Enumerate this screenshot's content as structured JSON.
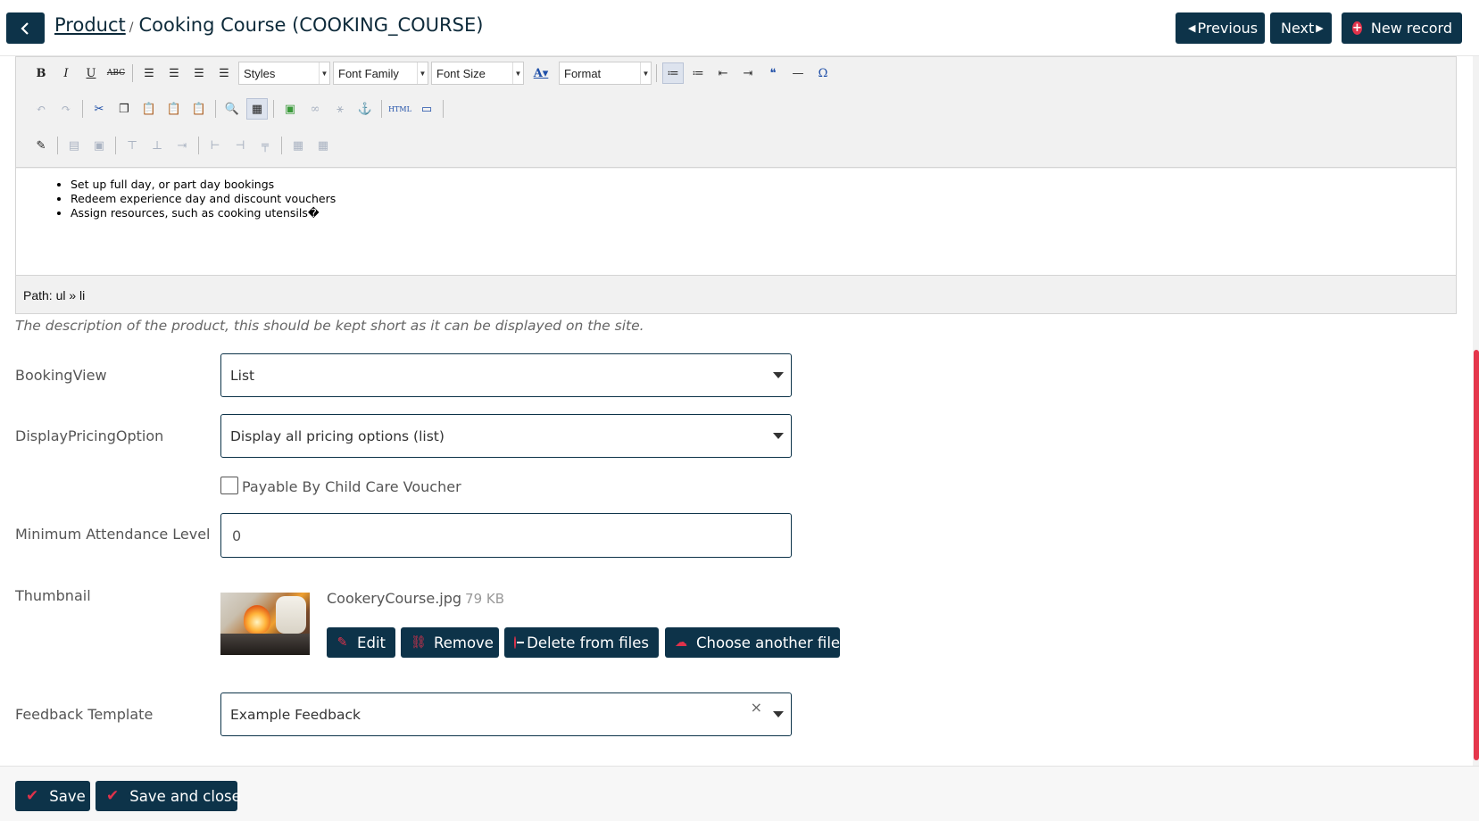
{
  "header": {
    "back_icon": "chevron-left-icon",
    "breadcrumb": "Product",
    "separator": "/",
    "title": "Cooking Course (COOKING_COURSE)",
    "previous_label": "Previous",
    "next_label": "Next",
    "new_record_label": "New record"
  },
  "editor": {
    "toolbar": {
      "styles": "Styles",
      "font_family": "Font Family",
      "font_size": "Font Size",
      "format": "Format"
    },
    "content_items": [
      "Set up full day, or part day bookings",
      "Redeem experience day and discount vouchers",
      "Assign resources, such as cooking utensils�"
    ],
    "path": "Path: ul » li"
  },
  "description_help": "The description of the product, this should be kept short as it can be displayed on the site.",
  "form": {
    "booking_view": {
      "label": "BookingView",
      "value": "List"
    },
    "display_pricing": {
      "label": "DisplayPricingOption",
      "value": "Display all pricing options (list)"
    },
    "child_care_voucher": {
      "label": "Payable By Child Care Voucher",
      "checked": false
    },
    "min_attendance": {
      "label": "Minimum Attendance Level",
      "value": "0"
    },
    "thumbnail": {
      "label": "Thumbnail",
      "filename": "CookeryCourse.jpg",
      "size": "79 KB",
      "edit_label": "Edit",
      "remove_label": "Remove",
      "delete_label": "Delete from files",
      "choose_label": "Choose another file"
    },
    "feedback_template": {
      "label": "Feedback Template",
      "value": "Example Feedback",
      "clear": "×"
    }
  },
  "footer": {
    "save_label": "Save",
    "save_close_label": "Save and close"
  },
  "colors": {
    "primary": "#0d3349",
    "accent": "#e0324b"
  }
}
